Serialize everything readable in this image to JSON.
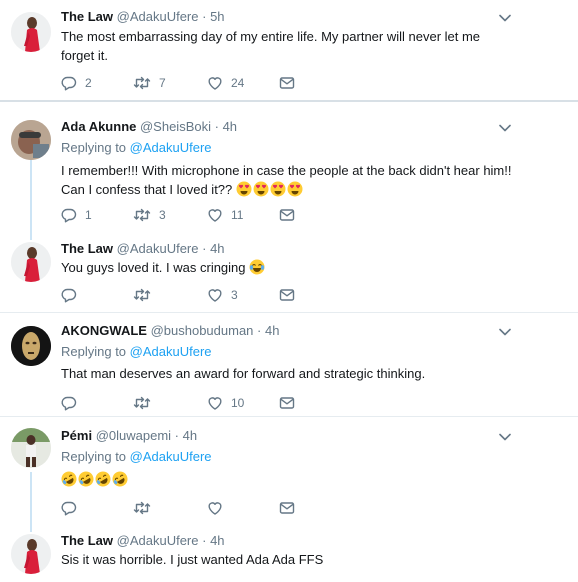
{
  "tweets": [
    {
      "name": "The Law",
      "handle": "@AdakuUfere",
      "time": "· 5h",
      "text": "The most embarrassing day of my entire life. My partner will never let me forget it.",
      "replies": "2",
      "retweets": "7",
      "likes": "24"
    },
    {
      "name": "Ada Akunne",
      "handle": "@SheisBoki",
      "time": "· 4h",
      "replying_label": "Replying to",
      "replying_to": "@AdakuUfere",
      "text": "I remember!!! With microphone in case the people at the back didn't hear him!! Can I confess that I loved it??",
      "emojis": [
        "heart-eyes",
        "heart-eyes",
        "heart-eyes",
        "heart-eyes"
      ],
      "replies": "1",
      "retweets": "3",
      "likes": "11"
    },
    {
      "name": "The Law",
      "handle": "@AdakuUfere",
      "time": "· 4h",
      "text": "You guys loved it. I was cringing",
      "emojis": [
        "joy"
      ],
      "replies": "",
      "retweets": "",
      "likes": "3"
    },
    {
      "name": "AKONGWALE",
      "handle": "@bushobuduman",
      "time": "· 4h",
      "replying_label": "Replying to",
      "replying_to": "@AdakuUfere",
      "text": "That man deserves an award for forward and strategic thinking.",
      "replies": "",
      "retweets": "",
      "likes": "10"
    },
    {
      "name": "Pémi",
      "handle": "@0luwapemi",
      "time": "· 4h",
      "replying_label": "Replying to",
      "replying_to": "@AdakuUfere",
      "text": "",
      "emojis": [
        "rofl",
        "rofl",
        "rofl",
        "rofl"
      ],
      "replies": "",
      "retweets": "",
      "likes": ""
    },
    {
      "name": "The Law",
      "handle": "@AdakuUfere",
      "time": "· 4h",
      "text": "Sis it was horrible. I just wanted Ada Ada FFS"
    }
  ],
  "colors": {
    "accent": "#1da1f2",
    "muted": "#657786",
    "text": "#14171a",
    "divider": "#e6ecf0",
    "thread_line": "#cce4f5"
  },
  "icons": {
    "reply": "reply-icon",
    "retweet": "retweet-icon",
    "like": "heart-icon",
    "dm": "envelope-icon",
    "caret": "chevron-down-icon"
  }
}
